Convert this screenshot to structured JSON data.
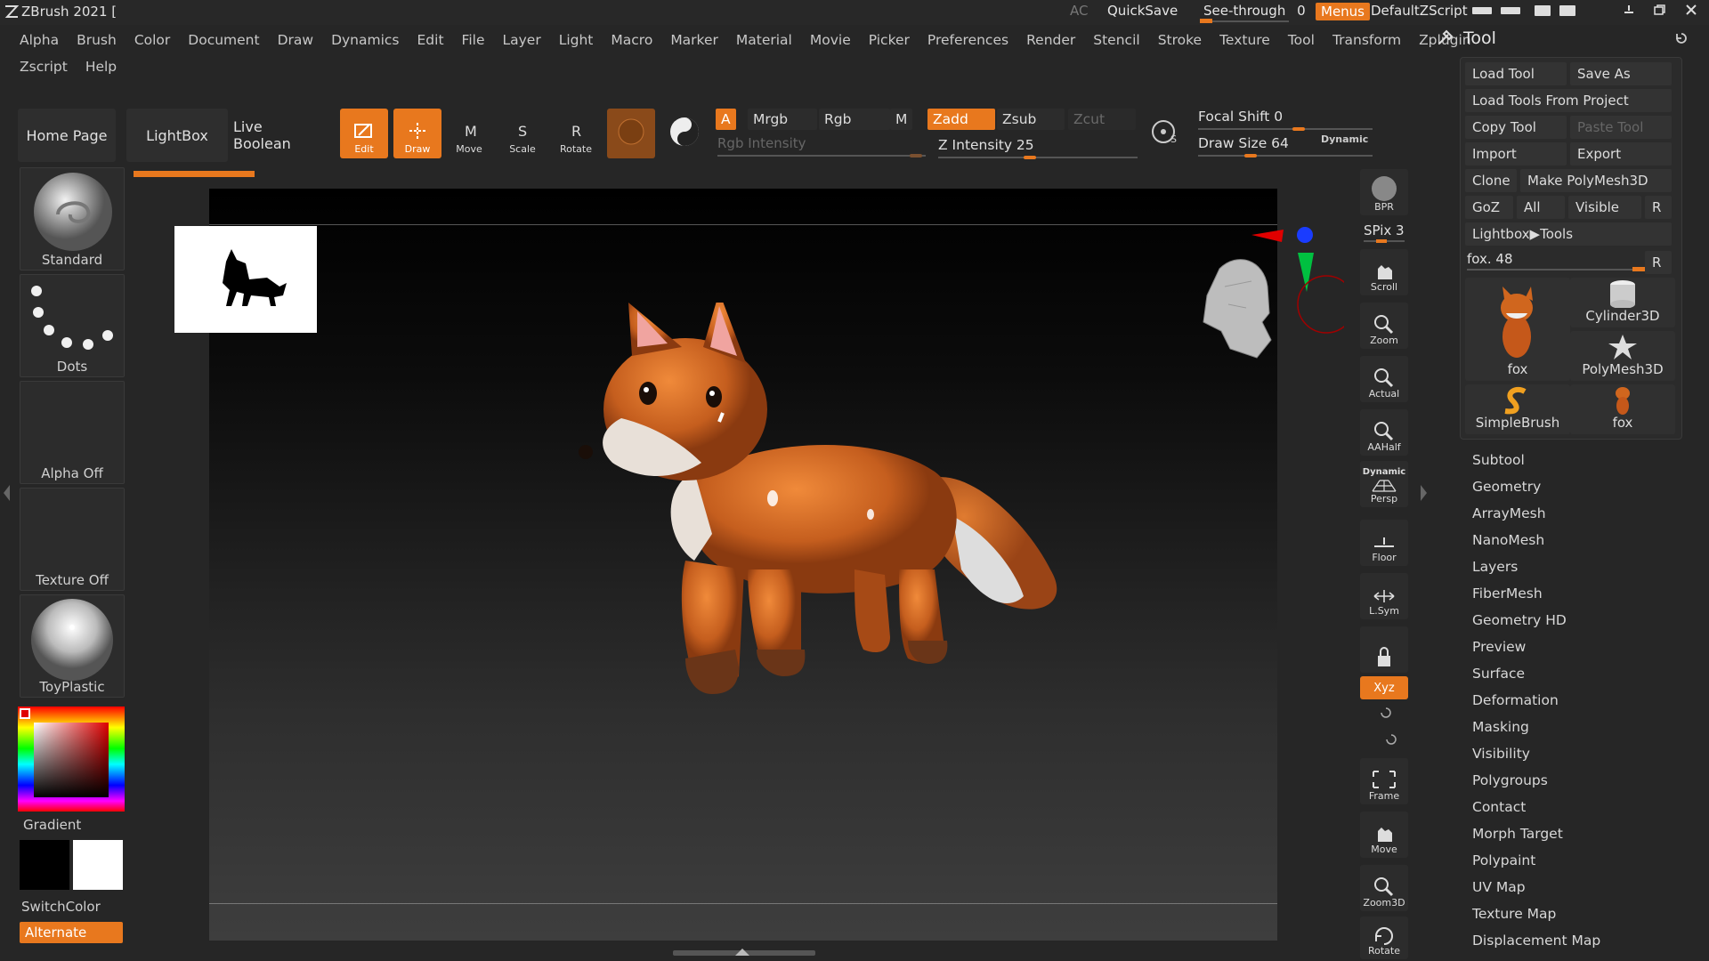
{
  "app": {
    "title": "ZBrush 2021 ["
  },
  "titlebar": {
    "ac": "AC",
    "quicksave": "QuickSave",
    "see_through_label": "See-through",
    "see_through_value": "0",
    "menus": "Menus",
    "script": "DefaultZScript"
  },
  "menu": {
    "row1": [
      "Alpha",
      "Brush",
      "Color",
      "Document",
      "Draw",
      "Dynamics",
      "Edit",
      "File",
      "Layer",
      "Light",
      "Macro",
      "Marker",
      "Material",
      "Movie",
      "Picker",
      "Preferences",
      "Render",
      "Stencil",
      "Stroke",
      "Texture",
      "Tool",
      "Transform",
      "Zplugin"
    ],
    "row2": [
      "Zscript",
      "Help"
    ]
  },
  "toolbar": {
    "home_page": "Home Page",
    "lightbox": "LightBox",
    "live_boolean": "Live Boolean",
    "edit": "Edit",
    "draw": "Draw",
    "move": "Move",
    "scale": "Scale",
    "rotate": "Rotate",
    "a": "A",
    "mrgb": "Mrgb",
    "rgb": "Rgb",
    "m": "M",
    "rgb_intensity": "Rgb Intensity",
    "zadd": "Zadd",
    "zsub": "Zsub",
    "zcut": "Zcut",
    "z_intensity": "Z Intensity 25",
    "focal_shift": "Focal Shift 0",
    "draw_size": "Draw Size 64",
    "dynamic": "Dynamic"
  },
  "left_panel": {
    "brush": "Standard",
    "stroke": "Dots",
    "alpha": "Alpha Off",
    "texture": "Texture Off",
    "material": "ToyPlastic",
    "gradient": "Gradient",
    "switch_color": "SwitchColor",
    "alternate": "Alternate"
  },
  "right_column": {
    "bpr": "BPR",
    "spix": "SPix 3",
    "scroll": "Scroll",
    "zoom": "Zoom",
    "actual": "Actual",
    "aahalf": "AAHalf",
    "dynamic": "Dynamic",
    "persp": "Persp",
    "floor": "Floor",
    "lsym": "L.Sym",
    "xyz": "Xyz",
    "frame": "Frame",
    "move": "Move",
    "zoom3d": "Zoom3D",
    "rotate": "Rotate"
  },
  "tool_panel": {
    "header": "Tool",
    "load_tool": "Load Tool",
    "save_as": "Save As",
    "load_from_project": "Load Tools From Project",
    "copy_tool": "Copy Tool",
    "paste_tool": "Paste Tool",
    "import": "Import",
    "export": "Export",
    "clone": "Clone",
    "make_polymesh": "Make PolyMesh3D",
    "goz": "GoZ",
    "all": "All",
    "visible": "Visible",
    "r": "R",
    "lightbox_tools": "Lightbox▶Tools",
    "current_tool": "fox. 48",
    "thumbs": [
      "fox",
      "Cylinder3D",
      "PolyMesh3D",
      "SimpleBrush",
      "fox"
    ],
    "sections": [
      "Subtool",
      "Geometry",
      "ArrayMesh",
      "NanoMesh",
      "Layers",
      "FiberMesh",
      "Geometry HD",
      "Preview",
      "Surface",
      "Deformation",
      "Masking",
      "Visibility",
      "Polygroups",
      "Contact",
      "Morph Target",
      "Polypaint",
      "UV Map",
      "Texture Map",
      "Displacement Map"
    ]
  },
  "colors": {
    "accent": "#e8781e",
    "background": "#262626"
  }
}
